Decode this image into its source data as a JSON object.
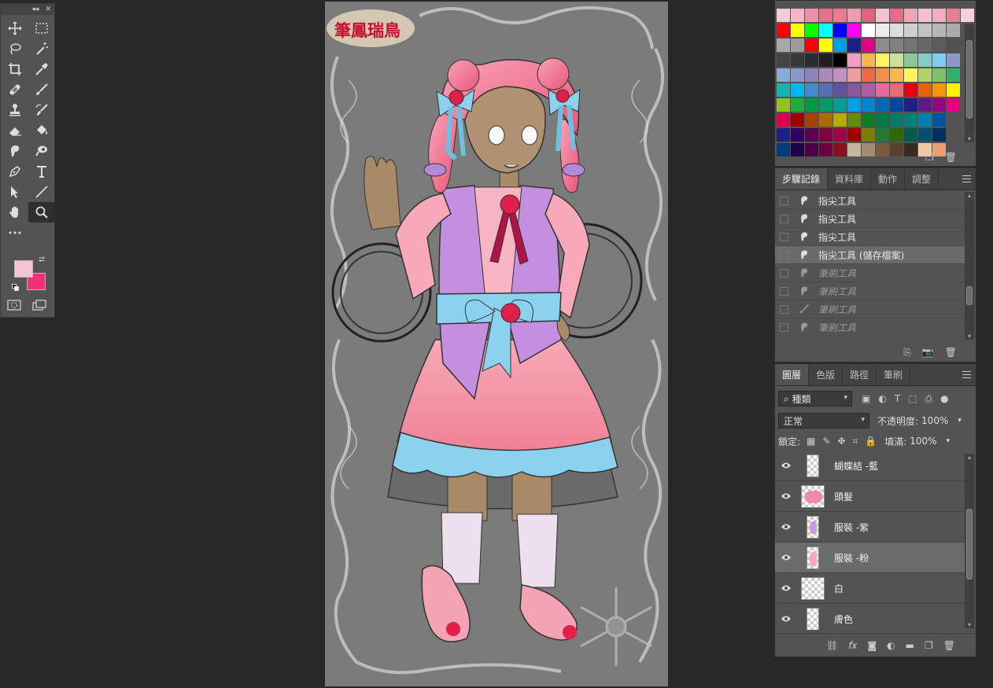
{
  "colors": {
    "foreground": "#f7c4d3",
    "background": "#f2307a"
  },
  "tools": [
    {
      "name": "move-tool",
      "icon": "move-icon"
    },
    {
      "name": "marquee-tool",
      "icon": "marquee-icon"
    },
    {
      "name": "lasso-tool",
      "icon": "lasso-icon"
    },
    {
      "name": "magic-wand-tool",
      "icon": "magic-wand-icon"
    },
    {
      "name": "crop-tool",
      "icon": "crop-icon"
    },
    {
      "name": "eyedropper-tool",
      "icon": "eyedropper-icon"
    },
    {
      "name": "healing-brush-tool",
      "icon": "bandage-icon"
    },
    {
      "name": "brush-tool",
      "icon": "brush-icon"
    },
    {
      "name": "clone-stamp-tool",
      "icon": "stamp-icon"
    },
    {
      "name": "history-brush-tool",
      "icon": "history-brush-icon"
    },
    {
      "name": "eraser-tool",
      "icon": "eraser-icon"
    },
    {
      "name": "paint-bucket-tool",
      "icon": "bucket-icon"
    },
    {
      "name": "smudge-tool",
      "icon": "smudge-icon"
    },
    {
      "name": "dodge-tool",
      "icon": "dodge-icon"
    },
    {
      "name": "pen-tool",
      "icon": "pen-icon"
    },
    {
      "name": "type-tool",
      "icon": "type-icon"
    },
    {
      "name": "path-selection-tool",
      "icon": "arrow-icon"
    },
    {
      "name": "line-tool",
      "icon": "line-icon"
    },
    {
      "name": "hand-tool",
      "icon": "hand-icon"
    },
    {
      "name": "zoom-tool",
      "icon": "zoom-icon"
    },
    {
      "name": "more-tools",
      "icon": "more-icon"
    }
  ],
  "swatches": {
    "rows": [
      [
        "#f6cbd6",
        "#f4b7c7",
        "#ee8fa8",
        "#e56f8c",
        "#ec7a95",
        "#f09bb1",
        "#e2637f",
        "#f5c3d0",
        "#e96b87",
        "#f0a4b8",
        "#f6bfcc",
        "#f3aebf",
        "#e67f98",
        "#f8d0da"
      ],
      [
        "#ff0000",
        "#ffff00",
        "#00ff00",
        "#00ffff",
        "#0000ff",
        "#ff00ff",
        "#ffffff",
        "#ececec",
        "#dcdcdc",
        "#cfcfcf",
        "#c3c3c3",
        "#b7b7b7",
        "#ababab"
      ],
      [
        "#a8a8a8",
        "#9c9c9c",
        "#ff0000",
        "#ffff00",
        "#00a0e9",
        "#1d2088",
        "#e4007f",
        "#8c8c8c",
        "#808080",
        "#747474",
        "#686868",
        "#5c5c5c",
        "#505050"
      ],
      [
        "#444444",
        "#383838",
        "#2c2c2c",
        "#202020",
        "#000000",
        "#f19ec2",
        "#f8b551",
        "#fff45c",
        "#cce198",
        "#89c997",
        "#84ccc9",
        "#7ecef4",
        "#8c97cb"
      ],
      [
        "#88abda",
        "#8c97cb",
        "#8f82bc",
        "#aa89bd",
        "#c490bf",
        "#f09ba0",
        "#ec6941",
        "#f19149",
        "#f8b551",
        "#fff45c",
        "#b3d465",
        "#80c269",
        "#32b16c"
      ],
      [
        "#13b5b1",
        "#00b7ee",
        "#448aca",
        "#556fb5",
        "#5f52a0",
        "#8957a1",
        "#ae5da1",
        "#ea68a2",
        "#eb6877",
        "#e60012",
        "#eb6100",
        "#f39800",
        "#fff100"
      ],
      [
        "#8fc31f",
        "#22ac38",
        "#009944",
        "#009b6b",
        "#009e96",
        "#00a0e9",
        "#0086d1",
        "#0068b7",
        "#00479d",
        "#1d2088",
        "#601986",
        "#920783",
        "#e4007f"
      ],
      [
        "#e5004f",
        "#a40000",
        "#a84200",
        "#ac6a00",
        "#b7aa00",
        "#638c0b",
        "#097c25",
        "#007b43",
        "#007d65",
        "#00807b",
        "#0080b6",
        "#00549f"
      ],
      [
        "#1d2088",
        "#310061",
        "#5a0050",
        "#7f0043",
        "#a1004b",
        "#a40000",
        "#7d7d00",
        "#217a30",
        "#2a6a00",
        "#005a50",
        "#005070",
        "#003060"
      ],
      [
        "#003d79",
        "#20004d",
        "#4d004a",
        "#6d003e",
        "#8a0e1e",
        "#c4b4a0",
        "#a48a70",
        "#7a5a3a",
        "#5a4030",
        "#3a2a20",
        "#f2c9a0",
        "#e8a070"
      ]
    ]
  },
  "history": {
    "tabs": [
      "步驟記錄",
      "資料庫",
      "動作",
      "調整"
    ],
    "items": [
      {
        "label": "指尖工具",
        "icon": "smudge-icon",
        "state": "normal"
      },
      {
        "label": "指尖工具",
        "icon": "smudge-icon",
        "state": "normal"
      },
      {
        "label": "指尖工具",
        "icon": "smudge-icon",
        "state": "normal"
      },
      {
        "label": "指尖工具 (儲存檔案)",
        "icon": "smudge-icon",
        "state": "current"
      },
      {
        "label": "筆刷工具",
        "icon": "smudge-icon",
        "state": "undone"
      },
      {
        "label": "筆刷工具",
        "icon": "smudge-icon",
        "state": "undone"
      },
      {
        "label": "筆刷工具",
        "icon": "brush-icon",
        "state": "undone"
      },
      {
        "label": "筆刷工具",
        "icon": "smudge-icon",
        "state": "undone"
      }
    ]
  },
  "layers": {
    "tabs": [
      "圖層",
      "色版",
      "路徑",
      "筆刷"
    ],
    "filter_label": "種類",
    "blend_mode": "正常",
    "opacity_label": "不透明度:",
    "opacity_value": "100%",
    "lock_label": "鎖定:",
    "fill_label": "填滿:",
    "fill_value": "100%",
    "items": [
      {
        "name": "蝴蝶結 -藍",
        "thumb": "narrow",
        "selected": false
      },
      {
        "name": "頭髮",
        "thumb": "hair",
        "selected": false
      },
      {
        "name": "服裝 -紫",
        "thumb": "narrow-purple",
        "selected": false
      },
      {
        "name": "服裝 -粉",
        "thumb": "narrow-pink",
        "selected": true
      },
      {
        "name": "白",
        "thumb": "wide",
        "selected": false
      },
      {
        "name": "膚色",
        "thumb": "narrow",
        "selected": false
      }
    ]
  },
  "canvas": {
    "logo_text": "筆鳳瑞鳥"
  }
}
